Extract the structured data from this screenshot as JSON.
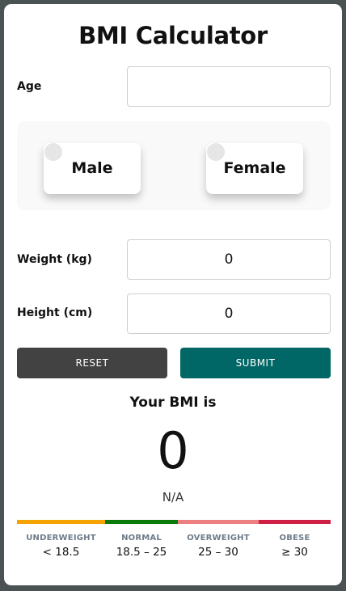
{
  "title": "BMI Calculator",
  "age": {
    "label": "Age",
    "value": "",
    "placeholder": ""
  },
  "gender": {
    "options": [
      {
        "label": "Male",
        "selected": false
      },
      {
        "label": "Female",
        "selected": false
      }
    ]
  },
  "weight": {
    "label": "Weight (kg)",
    "value": "0"
  },
  "height": {
    "label": "Height (cm)",
    "value": "0"
  },
  "buttons": {
    "reset": "RESET",
    "submit": "SUBMIT"
  },
  "result": {
    "heading": "Your BMI is",
    "value": "0",
    "category": "N/A"
  },
  "scale": [
    {
      "name": "UNDERWEIGHT",
      "range": "< 18.5",
      "color": "#f5a300"
    },
    {
      "name": "NORMAL",
      "range": "18.5 – 25",
      "color": "#0a7a0a"
    },
    {
      "name": "OVERWEIGHT",
      "range": "25 – 30",
      "color": "#ec8080"
    },
    {
      "name": "OBESE",
      "range": "≥ 30",
      "color": "#d01f45"
    }
  ],
  "colors": {
    "background": "#4a5253",
    "reset_button": "#424242",
    "submit_button": "#006666"
  }
}
